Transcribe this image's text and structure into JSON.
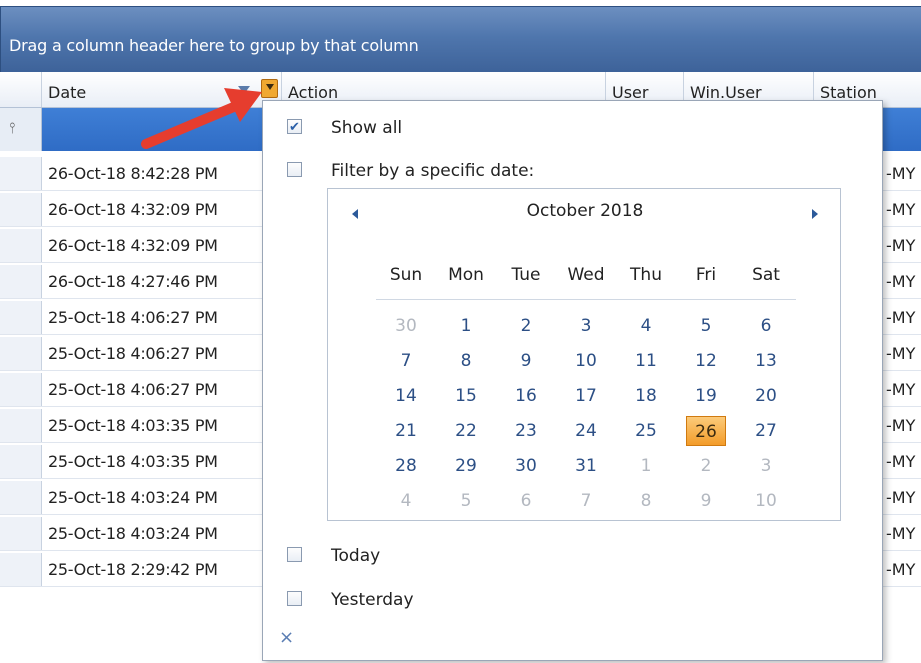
{
  "group_panel": {
    "hint": "Drag a column header here to group by that column"
  },
  "columns": {
    "date": "Date",
    "action": "Action",
    "user": "User",
    "win_user": "Win.User",
    "station": "Station"
  },
  "rows": [
    {
      "date": "26-Oct-18 8:42:28 PM",
      "station_fragment": "-MY"
    },
    {
      "date": "26-Oct-18 4:32:09 PM",
      "station_fragment": "-MY"
    },
    {
      "date": "26-Oct-18 4:32:09 PM",
      "station_fragment": "-MY"
    },
    {
      "date": "26-Oct-18 4:27:46 PM",
      "station_fragment": "-MY"
    },
    {
      "date": "25-Oct-18 4:06:27 PM",
      "station_fragment": "-MY"
    },
    {
      "date": "25-Oct-18 4:06:27 PM",
      "station_fragment": "-MY"
    },
    {
      "date": "25-Oct-18 4:06:27 PM",
      "station_fragment": "-MY"
    },
    {
      "date": "25-Oct-18 4:03:35 PM",
      "station_fragment": "-MY"
    },
    {
      "date": "25-Oct-18 4:03:35 PM",
      "station_fragment": "-MY"
    },
    {
      "date": "25-Oct-18 4:03:24 PM",
      "station_fragment": "-MY"
    },
    {
      "date": "25-Oct-18 4:03:24 PM",
      "station_fragment": "-MY"
    },
    {
      "date": "25-Oct-18 2:29:42 PM",
      "station_fragment": "-MY"
    }
  ],
  "filter_popup": {
    "show_all": {
      "label": "Show all",
      "checked": true
    },
    "specific_date": {
      "label": "Filter by a specific date:",
      "checked": false
    },
    "today": {
      "label": "Today",
      "checked": false
    },
    "yesterday": {
      "label": "Yesterday",
      "checked": false
    },
    "clear_glyph": "×",
    "calendar": {
      "title": "October 2018",
      "weekdays": [
        "Sun",
        "Mon",
        "Tue",
        "Wed",
        "Thu",
        "Fri",
        "Sat"
      ],
      "weeks": [
        [
          "30",
          "1",
          "2",
          "3",
          "4",
          "5",
          "6"
        ],
        [
          "7",
          "8",
          "9",
          "10",
          "11",
          "12",
          "13"
        ],
        [
          "14",
          "15",
          "16",
          "17",
          "18",
          "19",
          "20"
        ],
        [
          "21",
          "22",
          "23",
          "24",
          "25",
          "26",
          "27"
        ],
        [
          "28",
          "29",
          "30",
          "31",
          "1",
          "2",
          "3"
        ],
        [
          "4",
          "5",
          "6",
          "7",
          "8",
          "9",
          "10"
        ]
      ],
      "selected_day": "26",
      "selected_color": "#f39c2a"
    }
  },
  "icons": {
    "sort": "sort-descending-icon",
    "filter_button": "filter-dropdown-icon",
    "filter_row": "funnel-icon",
    "annotation": "red-arrow-icon"
  },
  "colors": {
    "header_bar": "#4f76ad",
    "filter_row": "#3f7fd6",
    "arrow": "#e63d2e"
  }
}
